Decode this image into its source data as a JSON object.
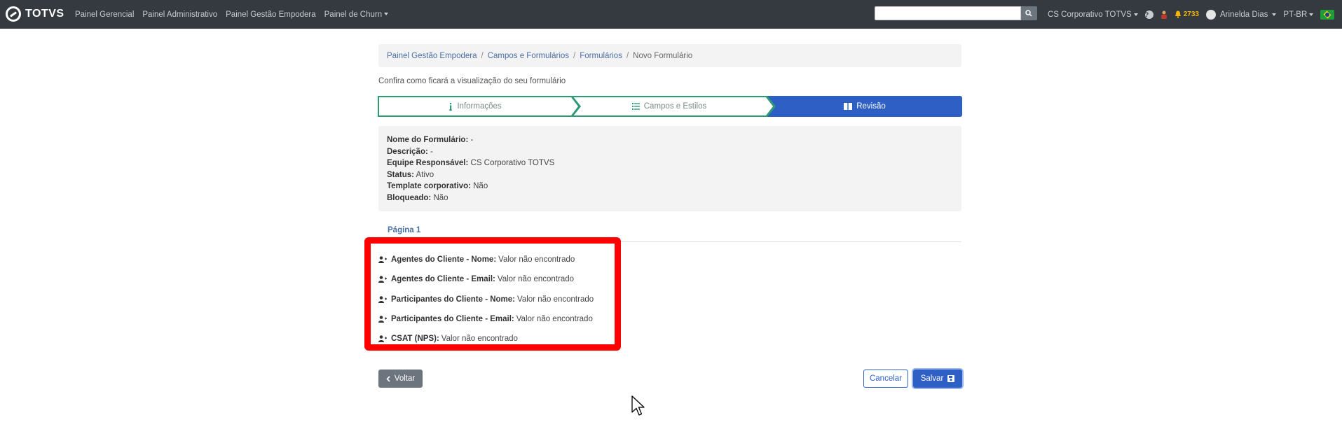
{
  "navbar": {
    "brand": "TOTVS",
    "links": [
      "Painel Gerencial",
      "Painel Administrativo",
      "Painel Gestão Empodera",
      "Painel de Churn"
    ],
    "search_placeholder": "",
    "team": "CS Corporativo TOTVS",
    "help": "?",
    "notifications": "2733",
    "user": "Arinelda Dias",
    "language": "PT-BR"
  },
  "breadcrumb": {
    "items": [
      "Painel Gestão Empodera",
      "Campos e Formulários",
      "Formulários"
    ],
    "current": "Novo Formulário"
  },
  "info_text": "Confira como ficará a visualização do seu formulário",
  "wizard": {
    "steps": [
      "Informações",
      "Campos e Estilos",
      "Revisão"
    ],
    "active_step": "Revisão"
  },
  "summary": [
    {
      "label": "Nome do Formulário:",
      "value": "-"
    },
    {
      "label": "Descrição:",
      "value": "-"
    },
    {
      "label": "Equipe Responsável:",
      "value": "CS Corporativo TOTVS"
    },
    {
      "label": "Status:",
      "value": "Ativo"
    },
    {
      "label": "Template corporativo:",
      "value": "Não"
    },
    {
      "label": "Bloqueado:",
      "value": "Não"
    }
  ],
  "tab": "Página 1",
  "fields": [
    {
      "label": "Agentes do Cliente - Nome:",
      "value": "Valor não encontrado"
    },
    {
      "label": "Agentes do Cliente - Email:",
      "value": "Valor não encontrado"
    },
    {
      "label": "Participantes do Cliente - Nome:",
      "value": "Valor não encontrado"
    },
    {
      "label": "Participantes do Cliente - Email:",
      "value": "Valor não encontrado"
    },
    {
      "label": "CSAT (NPS):",
      "value": "Valor não encontrado"
    }
  ],
  "buttons": {
    "back": "Voltar",
    "cancel": "Cancelar",
    "save": "Salvar"
  },
  "colors": {
    "navbar": "#343a40",
    "primary": "#2d5fc4",
    "step_border": "#2e9b73",
    "highlight": "#ff0000"
  }
}
